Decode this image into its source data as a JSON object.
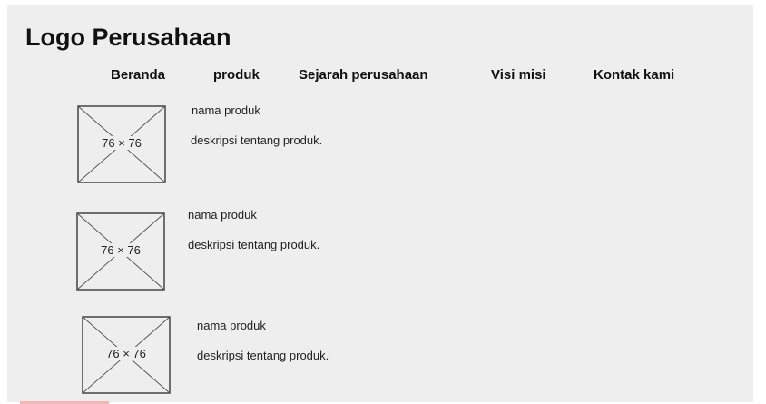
{
  "header": {
    "logo_text": "Logo Perusahaan"
  },
  "nav": [
    {
      "label": "Beranda"
    },
    {
      "label": "produk"
    },
    {
      "label": "Sejarah perusahaan"
    },
    {
      "label": "Visi misi"
    },
    {
      "label": "Kontak kami"
    }
  ],
  "products": [
    {
      "image_label": "76 × 76",
      "name": "nama produk",
      "description": "deskripsi tentang produk."
    },
    {
      "image_label": "76 × 76",
      "name": "nama produk",
      "description": "deskripsi tentang produk."
    },
    {
      "image_label": "76 × 76",
      "name": "nama produk",
      "description": "deskripsi tentang produk."
    }
  ]
}
